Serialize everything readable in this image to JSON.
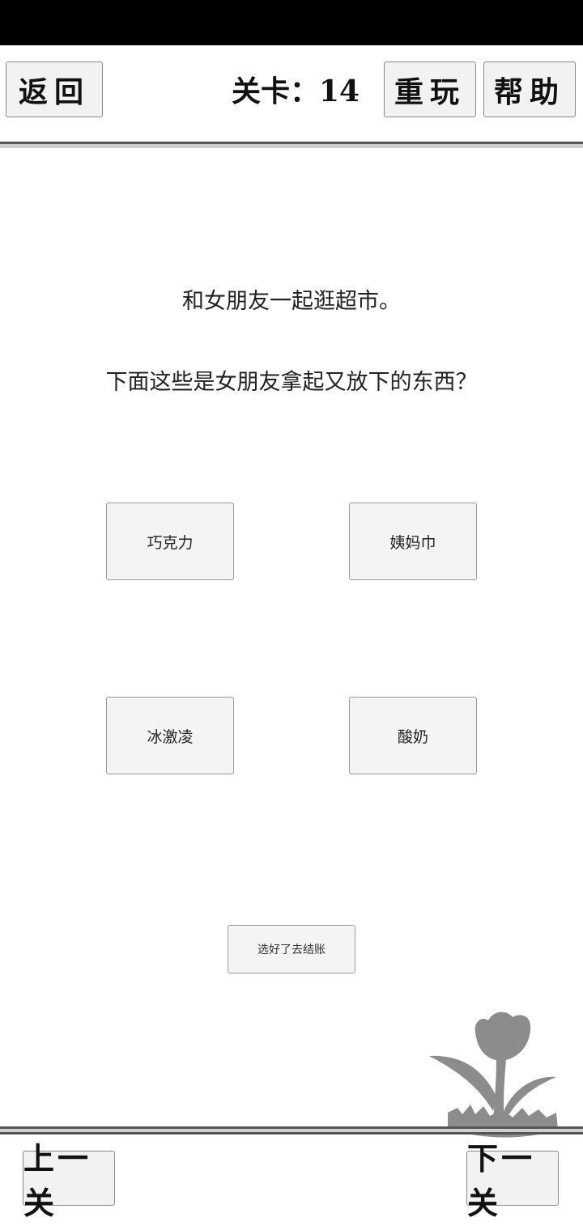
{
  "header": {
    "back_label": "返回",
    "level_label": "关卡：14",
    "replay_label": "重玩",
    "help_label": "帮助"
  },
  "question": {
    "line1": "和女朋友一起逛超市。",
    "line2": "下面这些是女朋友拿起又放下的东西？"
  },
  "choices": [
    {
      "label": "巧克力"
    },
    {
      "label": "姨妈巾"
    },
    {
      "label": "冰激凌"
    },
    {
      "label": "酸奶"
    }
  ],
  "checkout_label": "选好了去结账",
  "footer": {
    "prev_label": "上一关",
    "next_label": "下一关"
  },
  "colors": {
    "background": "#ffffff",
    "button_bg": "#f2f2f2",
    "flower": "#8c8c8c"
  }
}
